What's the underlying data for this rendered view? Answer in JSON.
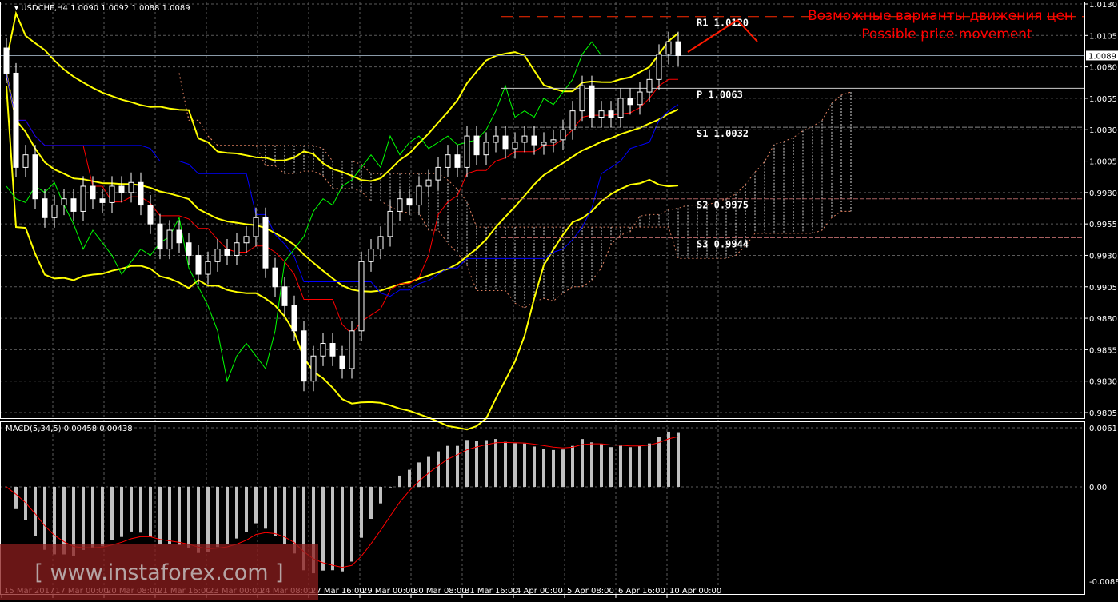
{
  "header": {
    "symbol": "USDCHF,H4",
    "ohlc": "1.0090 1.0092 1.0088 1.0089"
  },
  "annotation": {
    "ru": "Возможные варианты движения цен",
    "en": "Possible price movement"
  },
  "pivots": [
    {
      "label": "R1",
      "value": 1.012,
      "text": "R1 1.0120",
      "color": "#ff2a00"
    },
    {
      "label": "P",
      "value": 1.0063,
      "text": "P 1.0063",
      "color": "#cccccc"
    },
    {
      "label": "S1",
      "value": 1.0032,
      "text": "S1 1.0032",
      "color": "#888888"
    },
    {
      "label": "S2",
      "value": 0.9975,
      "text": "S2 0.9975",
      "color": "#a86060"
    },
    {
      "label": "S3",
      "value": 0.9944,
      "text": "S3 0.9944",
      "color": "#a86060"
    }
  ],
  "current_price": "1.0089",
  "macd": {
    "label": "MACD(5,34,5) 0.00458 0.00438",
    "ticks": [
      "0.0061",
      "0.00",
      "-0.0088"
    ]
  },
  "watermark": "[ www.instaforex.com ]",
  "colors": {
    "up": "#ffffff",
    "down": "#ffffff",
    "bands": "#ffff00",
    "ma": "#ff0000",
    "kijun": "#0000ff",
    "chikou": "#00ff00",
    "grid": "#5a5a5a"
  },
  "chart_data": {
    "type": "candlestick",
    "title": "USDCHF,H4",
    "ylim": [
      0.9805,
      1.013
    ],
    "y_ticks": [
      "1.0130",
      "1.0105",
      "1.0080",
      "1.0055",
      "1.0030",
      "1.0005",
      "0.9980",
      "0.9955",
      "0.9930",
      "0.9905",
      "0.9880",
      "0.9855",
      "0.9830",
      "0.9805"
    ],
    "x_ticks": [
      "15 Mar 2017",
      "17 Mar 00:00",
      "20 Mar 08:00",
      "21 Mar 16:00",
      "23 Mar 00:00",
      "24 Mar 08:00",
      "27 Mar 16:00",
      "29 Mar 00:00",
      "30 Mar 08:00",
      "31 Mar 16:00",
      "4 Apr 00:00",
      "5 Apr 08:00",
      "6 Apr 16:00",
      "10 Apr 00:00"
    ],
    "close": [
      1.0075,
      1.0,
      1.001,
      0.9975,
      0.996,
      0.997,
      0.9975,
      0.9965,
      0.9985,
      0.9975,
      0.9972,
      0.9985,
      0.998,
      0.9988,
      0.997,
      0.9955,
      0.9935,
      0.995,
      0.994,
      0.993,
      0.9915,
      0.9925,
      0.9935,
      0.993,
      0.994,
      0.9945,
      0.996,
      0.992,
      0.9905,
      0.989,
      0.987,
      0.983,
      0.985,
      0.986,
      0.985,
      0.984,
      0.987,
      0.9925,
      0.9935,
      0.9945,
      0.9965,
      0.9975,
      0.997,
      0.9985,
      0.999,
      1.0,
      1.001,
      1.0,
      1.0025,
      1.001,
      1.002,
      1.0025,
      1.0015,
      1.002,
      1.0025,
      1.0018,
      1.002,
      1.0022,
      1.003,
      1.0045,
      1.0065,
      1.004,
      1.0045,
      1.004,
      1.0055,
      1.005,
      1.006,
      1.007,
      1.009,
      1.01,
      1.0089
    ]
  }
}
